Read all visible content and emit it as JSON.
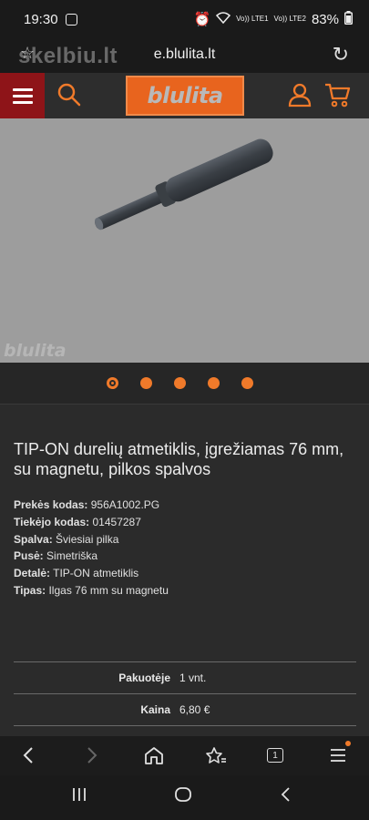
{
  "status_bar": {
    "time": "19:30",
    "signal1": "Vo)) LTE1",
    "signal2": "Vo)) LTE2",
    "battery": "83%"
  },
  "address_bar": {
    "watermark": "skelbiu.lt",
    "url": "e.blulita.lt",
    "icons": [
      "star-icon",
      "reload-icon"
    ]
  },
  "site_header": {
    "logo_text": "blulita",
    "icons": [
      "menu-icon",
      "search-icon",
      "user-icon",
      "cart-icon"
    ]
  },
  "product_image": {
    "watermark": "blulita"
  },
  "carousel": {
    "active_index": 0,
    "dot_count": 5
  },
  "product": {
    "title": "TIP-ON durelių atmetiklis, įgrežiamas 76 mm, su magnetu, pilkos spalvos",
    "specs": [
      {
        "label": "Prekės kodas:",
        "value": "956A1002.PG"
      },
      {
        "label": "Tiekėjo kodas:",
        "value": "01457287"
      },
      {
        "label": "Spalva:",
        "value": "Šviesiai pilka"
      },
      {
        "label": "Pusė:",
        "value": "Simetriška"
      },
      {
        "label": "Detalė:",
        "value": "TIP-ON atmetiklis"
      },
      {
        "label": "Tipas:",
        "value": "Ilgas 76 mm su magnetu"
      }
    ]
  },
  "price_table": {
    "rows": [
      {
        "label": "Pakuotėje",
        "value": "1 vnt."
      },
      {
        "label": "Kaina",
        "value": "6,80 €"
      }
    ]
  },
  "browser_nav": {
    "tabs_count": "1",
    "icons": [
      "back-icon",
      "forward-icon",
      "home-icon",
      "bookmarks-icon",
      "tabs-icon",
      "browser-menu-icon"
    ]
  },
  "system_nav": {
    "icons": [
      "recents-icon",
      "home-circle-icon",
      "system-back-icon"
    ]
  },
  "colors": {
    "accent": "#f07a2a",
    "menu_red": "#8e1418",
    "logo_orange": "#e8641e",
    "background": "#2b2b2b",
    "image_bg": "#9d9d9d"
  }
}
